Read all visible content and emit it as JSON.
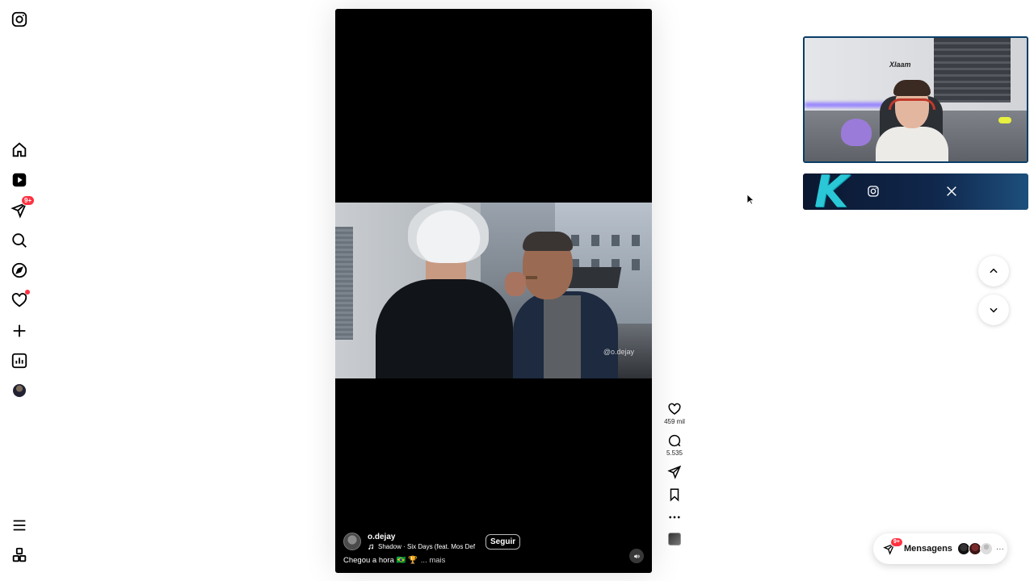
{
  "nav": {
    "items": [
      {
        "name": "instagram-logo-icon"
      },
      {
        "name": "home-icon"
      },
      {
        "name": "reels-icon"
      },
      {
        "name": "direct-messages-icon",
        "badge": "9+"
      },
      {
        "name": "search-icon"
      },
      {
        "name": "explore-icon"
      },
      {
        "name": "notifications-heart-icon",
        "dot": true
      },
      {
        "name": "create-plus-icon"
      },
      {
        "name": "dashboard-icon"
      },
      {
        "name": "profile-avatar"
      },
      {
        "name": "menu-icon"
      },
      {
        "name": "also-from-meta-icon"
      }
    ],
    "messages_badge": "9+"
  },
  "reel": {
    "watermark": "@o.dejay",
    "author": "o.dejay",
    "music": "Shadow · Six Days (feat. Mos Def",
    "follow_label": "Seguir",
    "caption": "Chegou a hora 🇧🇷 🏆",
    "more_label": "... mais"
  },
  "actions": {
    "likes": "459 mil",
    "comments": "5.535"
  },
  "overlay": {
    "cam_sign": "Xlaam",
    "logo_letter": "K"
  },
  "messages": {
    "label": "Mensagens",
    "badge": "9+",
    "more": "···"
  },
  "colors": {
    "accent_red": "#ff3040",
    "overlay_blue": "#10284d",
    "overlay_cyan": "#2ac7d6"
  }
}
